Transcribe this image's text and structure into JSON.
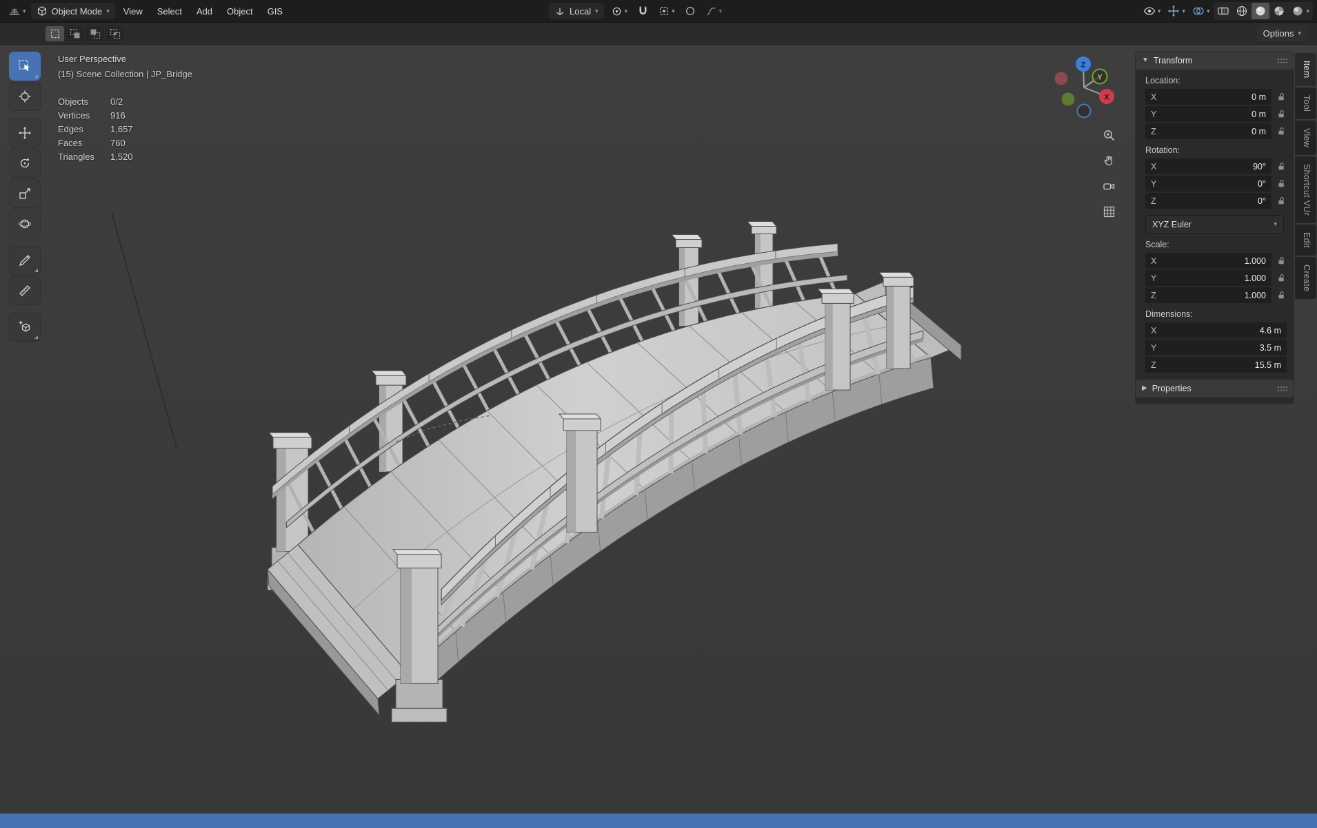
{
  "colors": {
    "accent_blue": "#4772b3",
    "header_bg": "#1d1d1d",
    "viewport_bg": "#3b3b3b",
    "panel_bg": "#292929",
    "field_bg": "#1f1f1f",
    "status_bar": "#4772b3",
    "axis_x": "#cc3e4e",
    "axis_y": "#74a62e",
    "axis_z": "#3d7ed8"
  },
  "icons": [
    "editor-3d-viewport-icon",
    "cube-icon",
    "orientation-axes-icon",
    "pivot-icon",
    "magnet-icon",
    "snap-target-icon",
    "proportional-circle-icon",
    "falloff-curve-icon",
    "eye-icon",
    "gizmo-arrows-icon",
    "overlays-icon",
    "xray-icon",
    "wireframe-sphere-icon",
    "solid-sphere-icon",
    "material-sphere-icon",
    "rendered-sphere-icon",
    "select-box-icon",
    "cursor-icon",
    "move-icon",
    "rotate-icon",
    "scale-icon",
    "transform-icon",
    "annotate-icon",
    "measure-icon",
    "add-cube-icon",
    "zoom-icon",
    "hand-icon",
    "camera-icon",
    "grid-icon",
    "lock-open-icon",
    "drag-dots-icon"
  ],
  "menubar": {
    "mode_label": "Object Mode",
    "menus": [
      "View",
      "Select",
      "Add",
      "Object",
      "GIS"
    ],
    "orientation_label": "Local"
  },
  "tool_settings": {
    "options_label": "Options"
  },
  "viewport": {
    "perspective_label": "User Perspective",
    "collection_label": "(15) Scene Collection | JP_Bridge",
    "stats": [
      {
        "label": "Objects",
        "value": "0/2"
      },
      {
        "label": "Vertices",
        "value": "916"
      },
      {
        "label": "Edges",
        "value": "1,657"
      },
      {
        "label": "Faces",
        "value": "760"
      },
      {
        "label": "Triangles",
        "value": "1,520"
      }
    ]
  },
  "gizmo": {
    "x_label": "X",
    "y_label": "Y",
    "z_label": "Z"
  },
  "sidebar": {
    "tabs": [
      "Item",
      "Tool",
      "View",
      "Shortcut VUr",
      "Edit",
      "Create"
    ],
    "transform_title": "Transform",
    "location": {
      "label": "Location:",
      "rows": [
        {
          "axis": "X",
          "value": "0 m"
        },
        {
          "axis": "Y",
          "value": "0 m"
        },
        {
          "axis": "Z",
          "value": "0 m"
        }
      ]
    },
    "rotation": {
      "label": "Rotation:",
      "rows": [
        {
          "axis": "X",
          "value": "90°"
        },
        {
          "axis": "Y",
          "value": "0°"
        },
        {
          "axis": "Z",
          "value": "0°"
        }
      ]
    },
    "euler_mode": "XYZ Euler",
    "scale": {
      "label": "Scale:",
      "rows": [
        {
          "axis": "X",
          "value": "1.000"
        },
        {
          "axis": "Y",
          "value": "1.000"
        },
        {
          "axis": "Z",
          "value": "1.000"
        }
      ]
    },
    "dimensions": {
      "label": "Dimensions:",
      "rows": [
        {
          "axis": "X",
          "value": "4.6 m"
        },
        {
          "axis": "Y",
          "value": "3.5 m"
        },
        {
          "axis": "Z",
          "value": "15.5 m"
        }
      ]
    },
    "properties_title": "Properties"
  }
}
